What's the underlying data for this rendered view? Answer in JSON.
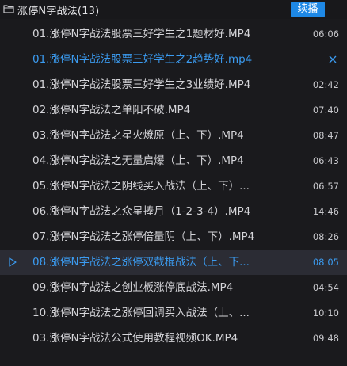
{
  "header": {
    "folder_title": "涨停N字战法(13)",
    "resume_label": "续播",
    "folder_icon": "folder-icon"
  },
  "colors": {
    "background": "#1a1a1d",
    "active_row": "#2b2c34",
    "accent_blue": "#3b9bf0",
    "button_blue": "#1e88e5",
    "text": "#d4d4d8"
  },
  "playlist": [
    {
      "title": "01.涨停N字战法股票三好学生之1题材好.MP4",
      "duration": "06:06"
    },
    {
      "title": "01.涨停N字战法股票三好学生之2趋势好.mp4",
      "duration": ""
    },
    {
      "title": "01.涨停N字战法股票三好学生之3业绩好.MP4",
      "duration": "02:42"
    },
    {
      "title": "02.涨停N字战法之单阳不破.MP4",
      "duration": "07:40"
    },
    {
      "title": "03.涨停N字战法之星火燎原（上、下）.MP4",
      "duration": "08:47"
    },
    {
      "title": "04.涨停N字战法之无量启爆（上、下）.MP4",
      "duration": "06:43"
    },
    {
      "title": "05.涨停N字战法之阴线买入战法（上、下）...",
      "duration": "06:57"
    },
    {
      "title": "06.涨停N字战法之众星捧月（1-2-3-4）.MP4",
      "duration": "14:46"
    },
    {
      "title": "07.涨停N字战法之涨停倍量阴（上、下）.MP4",
      "duration": "08:26"
    },
    {
      "title": "08.涨停N字战法之涨停双截棍战法（上、下...",
      "duration": "08:05"
    },
    {
      "title": "09.涨停N字战法之创业板涨停底战法.MP4",
      "duration": "04:54"
    },
    {
      "title": "10.涨停N字战法之涨停回调买入战法（上、...",
      "duration": "10:10"
    },
    {
      "title": "03.涨停N字战法公式使用教程视频OK.MP4",
      "duration": "09:48"
    }
  ]
}
